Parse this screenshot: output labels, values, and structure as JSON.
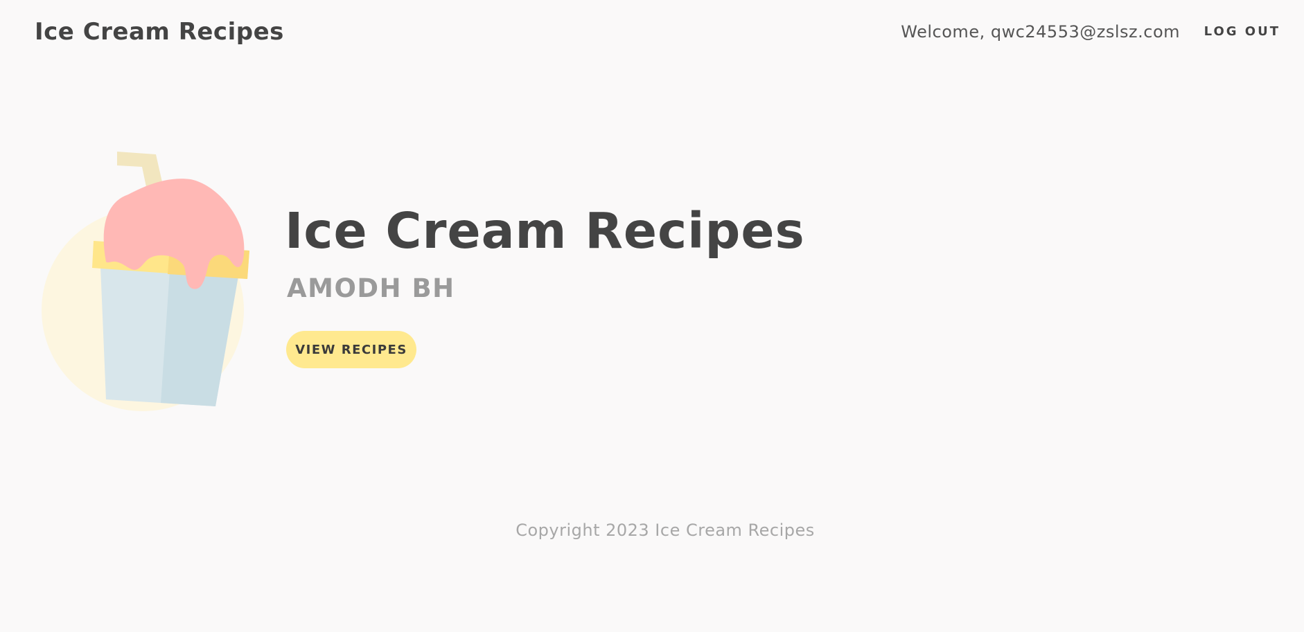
{
  "navbar": {
    "brand": "Ice Cream Recipes",
    "welcome": "Welcome, qwc24553@zslsz.com",
    "logout": "LOG OUT"
  },
  "hero": {
    "illustration_icon": "ice-cream-cup-icon",
    "title": "Ice Cream Recipes",
    "subtitle": "AMODH BH",
    "button_label": "VIEW RECIPES"
  },
  "footer": {
    "copyright": "Copyright 2023 Ice Cream Recipes"
  },
  "colors": {
    "background": "#faf9f9",
    "text_dark": "#444444",
    "subtitle": "#9a9a9a",
    "button_bg": "#ffe98f",
    "ice_cream_pink": "#ffb8b5",
    "cup_blue": "#d8e6eb",
    "cup_rim_yellow": "#ffe68a"
  }
}
